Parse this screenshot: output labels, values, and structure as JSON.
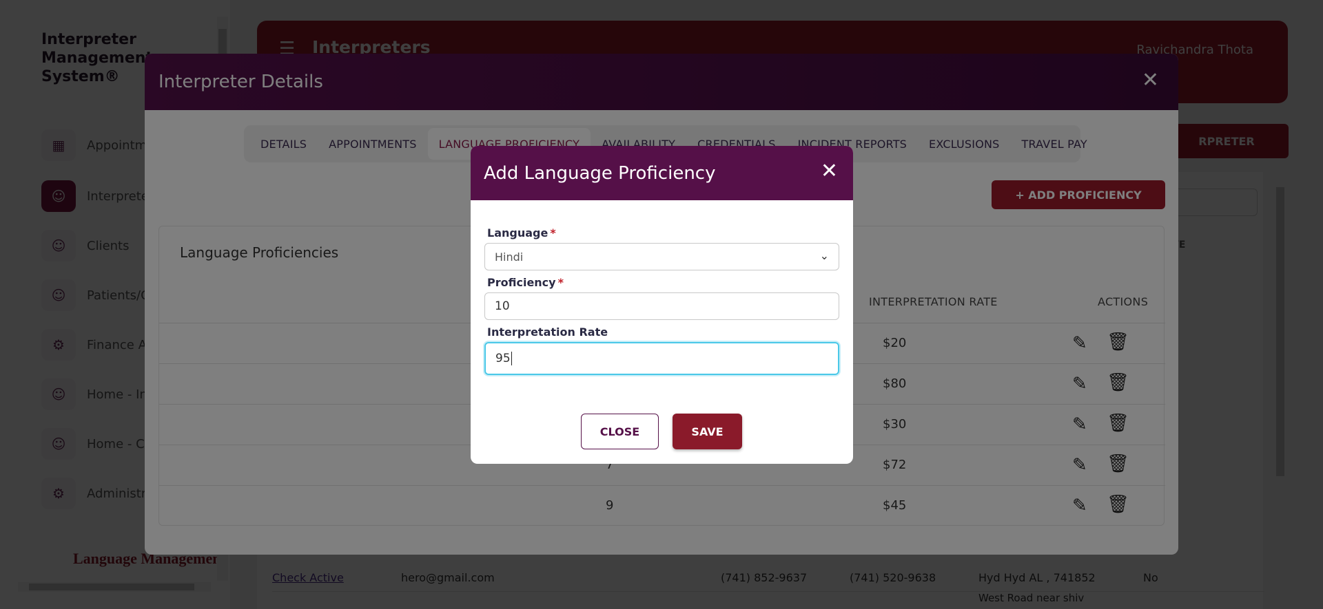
{
  "app": {
    "brand": "Interpreter Management System®",
    "user": "Ravichandra Thota",
    "page_title": "Interpreters",
    "add_interpreter_label": "RPRETER",
    "logo_text": "Language Management"
  },
  "sidebar": {
    "items": [
      {
        "label": "Appointm",
        "icon": "calendar-icon"
      },
      {
        "label": "Interprete",
        "icon": "person-icon"
      },
      {
        "label": "Clients",
        "icon": "people-icon"
      },
      {
        "label": "Patients/C",
        "icon": "patient-icon"
      },
      {
        "label": "Finance A",
        "icon": "gear-icon"
      },
      {
        "label": "Home - In",
        "icon": "person-icon"
      },
      {
        "label": "Home - C",
        "icon": "people-icon"
      },
      {
        "label": "Administr",
        "icon": "gear-icon"
      }
    ]
  },
  "background_table": {
    "partial_header": "VE",
    "row": {
      "name": "Check Active",
      "email": "hero@gmail.com",
      "phone1": "(741) 852-9637",
      "phone2": "(741) 520-9638",
      "address": "Hyd Hyd AL , 741852",
      "active": "No"
    },
    "next_row_address": "West Road near shiv"
  },
  "interpreter_dialog": {
    "title": "Interpreter Details",
    "tabs": [
      "DETAILS",
      "APPOINTMENTS",
      "LANGUAGE PROFICIENCY",
      "AVAILABILITY",
      "CREDENTIALS",
      "INCIDENT REPORTS",
      "EXCLUSIONS",
      "TRAVEL PAY"
    ],
    "active_tab": "LANGUAGE PROFICIENCY",
    "add_button": "+ ADD PROFICIENCY",
    "card_title": "Language Proficiencies",
    "columns": [
      "INTERPRETATION RATE",
      "ACTIONS"
    ],
    "rows": [
      {
        "proficiency": "",
        "rate": "$20"
      },
      {
        "proficiency": "",
        "rate": "$80"
      },
      {
        "proficiency": "",
        "rate": "$30"
      },
      {
        "proficiency": "7",
        "rate": "$72"
      },
      {
        "proficiency": "9",
        "rate": "$45"
      }
    ]
  },
  "modal": {
    "title": "Add Language Proficiency",
    "language_label": "Language",
    "language_value": "Hindi",
    "proficiency_label": "Proficiency",
    "proficiency_value": "10",
    "rate_label": "Interpretation Rate",
    "rate_value": "95",
    "required_mark": "*",
    "close_label": "CLOSE",
    "save_label": "SAVE"
  },
  "colors": {
    "brand_primary": "#9a1a2a",
    "dialog_header": "#551048",
    "focus_ring": "#4ac8e8"
  }
}
